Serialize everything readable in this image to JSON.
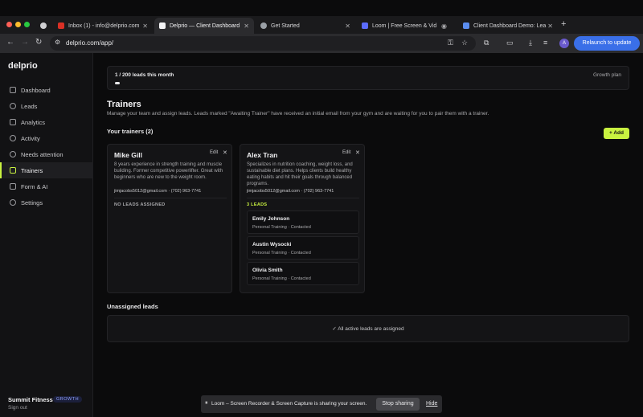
{
  "browser": {
    "tabs": [
      {
        "label": "Inbox (1) - info@delprio.com",
        "favicon_color": "#d93025"
      },
      {
        "label": "Delprio — Client Dashboard",
        "favicon_color": "#ffffff"
      },
      {
        "label": "Get Started",
        "favicon_color": "#9aa0a6"
      },
      {
        "label": "Loom | Free Screen & Vid",
        "favicon_color": "#5b6cff"
      },
      {
        "label": "Client Dashboard Demo: Lea",
        "favicon_color": "#5b8def"
      }
    ],
    "url": "delprio.com/app/",
    "relaunch_label": "Relaunch to update",
    "profile_initial": "A"
  },
  "sidebar": {
    "brand": "delprio",
    "items": [
      {
        "label": "Dashboard"
      },
      {
        "label": "Leads"
      },
      {
        "label": "Analytics"
      },
      {
        "label": "Activity"
      },
      {
        "label": "Needs attention"
      },
      {
        "label": "Trainers"
      },
      {
        "label": "Form & AI"
      },
      {
        "label": "Settings"
      }
    ],
    "org_name": "Summit Fitness",
    "org_plan_badge": "GROWTH",
    "signout": "Sign out"
  },
  "usage": {
    "text": "1 / 200 leads this month",
    "progress_fraction": 0.005,
    "plan": "Growth plan"
  },
  "page": {
    "title": "Trainers",
    "description": "Manage your team and assign leads. Leads marked \"Awaiting Trainer\" have received an initial email from your gym and are waiting for you to pair them with a trainer.",
    "trainers_heading": "Your trainers (2)",
    "add_label": "+ Add",
    "unassigned_heading": "Unassigned leads",
    "unassigned_message": "✓ All active leads are assigned"
  },
  "trainers": [
    {
      "name": "Mike Gill",
      "edit": "Edit",
      "close": "✕",
      "bio": "8 years experience in strength training and muscle building. Former competitive powerlifter. Great with beginners who are new to the weight room.",
      "contact": "jimjacobs5012@gmail.com · (702) 963-7741",
      "leads_label": "NO LEADS ASSIGNED",
      "leads": []
    },
    {
      "name": "Alex Tran",
      "edit": "Edit",
      "close": "✕",
      "bio": "Specializes in nutrition coaching, weight loss, and sustainable diet plans. Helps clients build healthy eating habits and hit their goals through balanced programs.",
      "contact": "jimjacobs5012@gmail.com · (702) 963-7741",
      "leads_label": "3 LEADS",
      "leads": [
        {
          "name": "Emily Johnson",
          "status": "Personal Training · Contacted"
        },
        {
          "name": "Austin Wysocki",
          "status": "Personal Training · Contacted"
        },
        {
          "name": "Olivia Smith",
          "status": "Personal Training · Contacted"
        }
      ]
    }
  ],
  "sharebar": {
    "text": "Loom – Screen Recorder & Screen Capture is sharing your screen.",
    "stop": "Stop sharing",
    "hide": "Hide"
  },
  "colors": {
    "accent": "#c9f240",
    "background": "#0b0b0c",
    "relaunch": "#3a6fe8"
  }
}
